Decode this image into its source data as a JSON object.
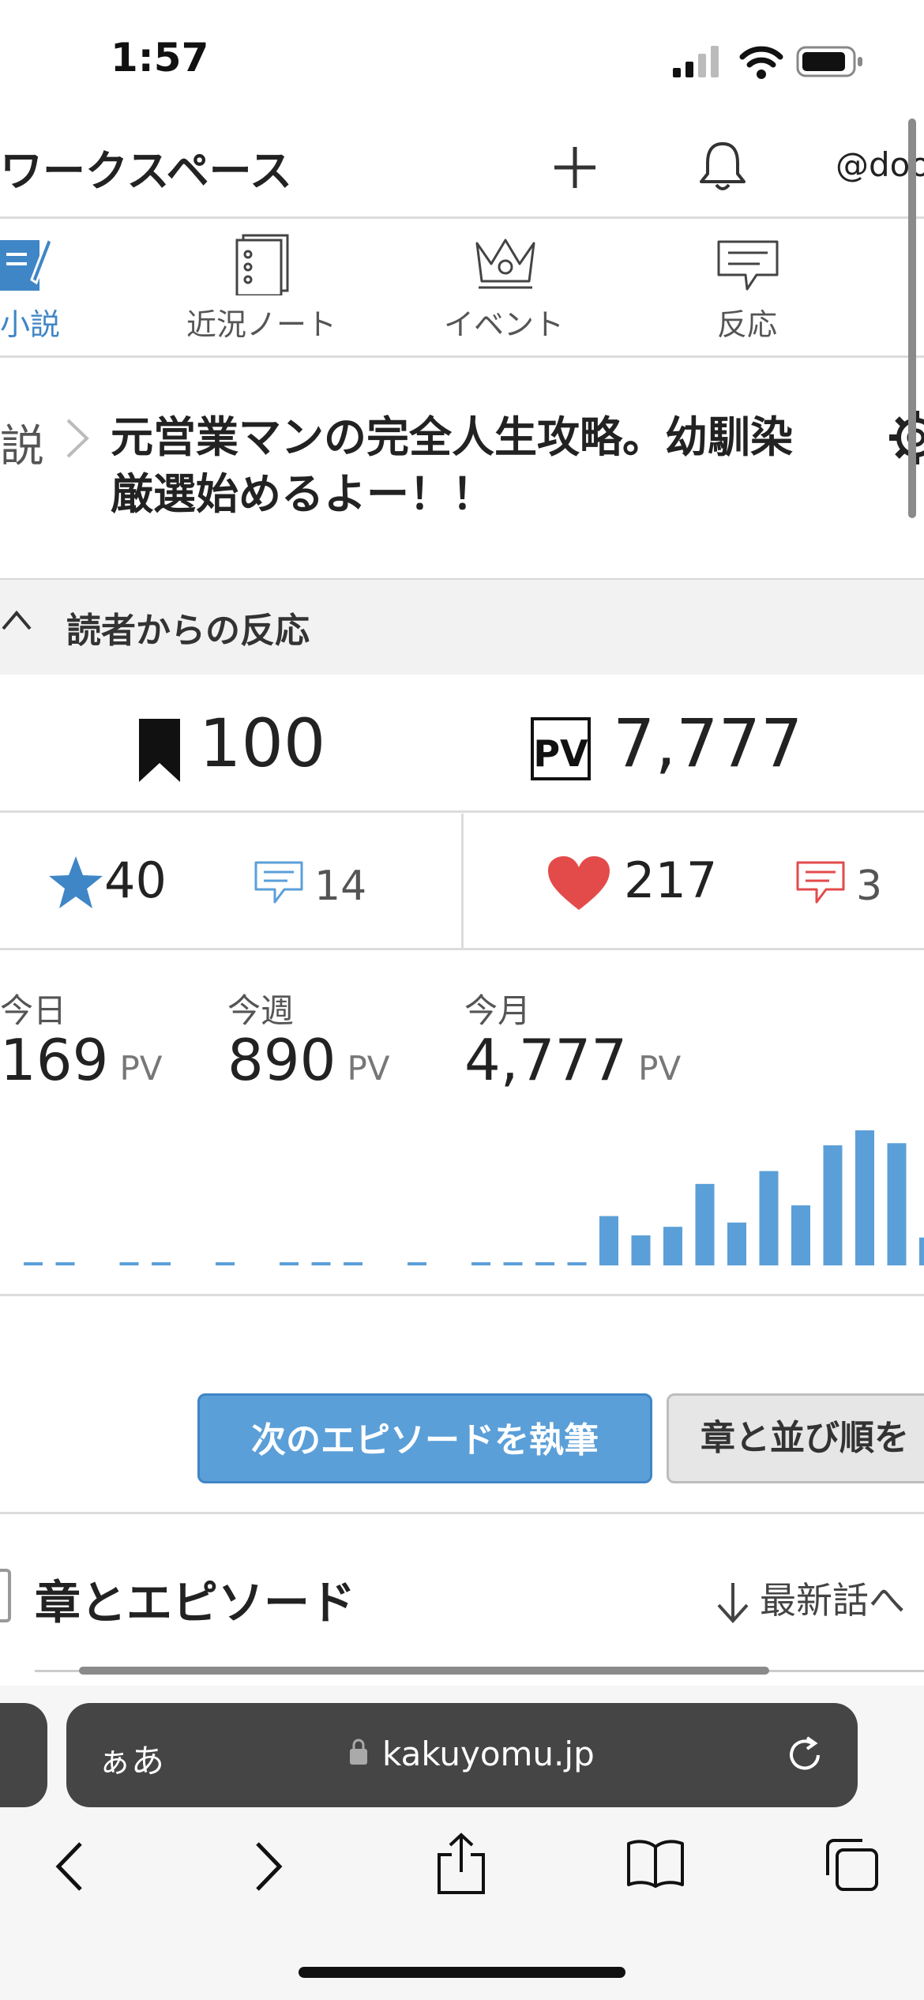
{
  "status_bar": {
    "time": "1:57"
  },
  "header": {
    "title": "ワークスペース",
    "user": "@doo"
  },
  "tabs": [
    {
      "label": "小説",
      "icon": "pen-paper-icon",
      "active": true
    },
    {
      "label": "近況ノート",
      "icon": "notebook-icon",
      "active": false
    },
    {
      "label": "イベント",
      "icon": "crown-icon",
      "active": false
    },
    {
      "label": "反応",
      "icon": "speech-bubble-icon",
      "active": false
    }
  ],
  "breadcrumb": {
    "parent": "説"
  },
  "novel": {
    "title": "元営業マンの完全人生攻略。幼馴染厳選始めるよー！！"
  },
  "reactions_section": {
    "label": "読者からの反応"
  },
  "counters": {
    "bookmarks": "100",
    "pv_total": "7,777",
    "stars": "40",
    "star_comments": "14",
    "hearts": "217",
    "heart_comments": "3"
  },
  "pv_stats": {
    "today": {
      "label": "今日",
      "value": "169",
      "unit": "PV"
    },
    "week": {
      "label": "今週",
      "value": "890",
      "unit": "PV"
    },
    "month": {
      "label": "今月",
      "value": "4,777",
      "unit": "PV"
    }
  },
  "chart_data": {
    "type": "bar",
    "values": [
      1,
      1,
      0,
      1,
      1,
      0,
      1,
      0,
      1,
      1.5,
      1,
      0,
      1,
      0,
      1,
      1,
      1.5,
      1,
      23,
      14,
      18,
      38,
      20,
      44,
      28,
      56,
      63,
      57,
      13
    ],
    "ylim": [
      0,
      70
    ],
    "color": "#5b9fd8"
  },
  "actions": {
    "write_next": "次のエピソードを執筆",
    "reorder": "章と並び順を"
  },
  "episodes": {
    "title": "章とエピソード",
    "sort": "最新話へ"
  },
  "browser": {
    "aa": "ぁあ",
    "host": "kakuyomu.jp"
  },
  "colors": {
    "accent": "#5b9fd8",
    "heart": "#e34b4b",
    "star": "#3f86c6"
  }
}
